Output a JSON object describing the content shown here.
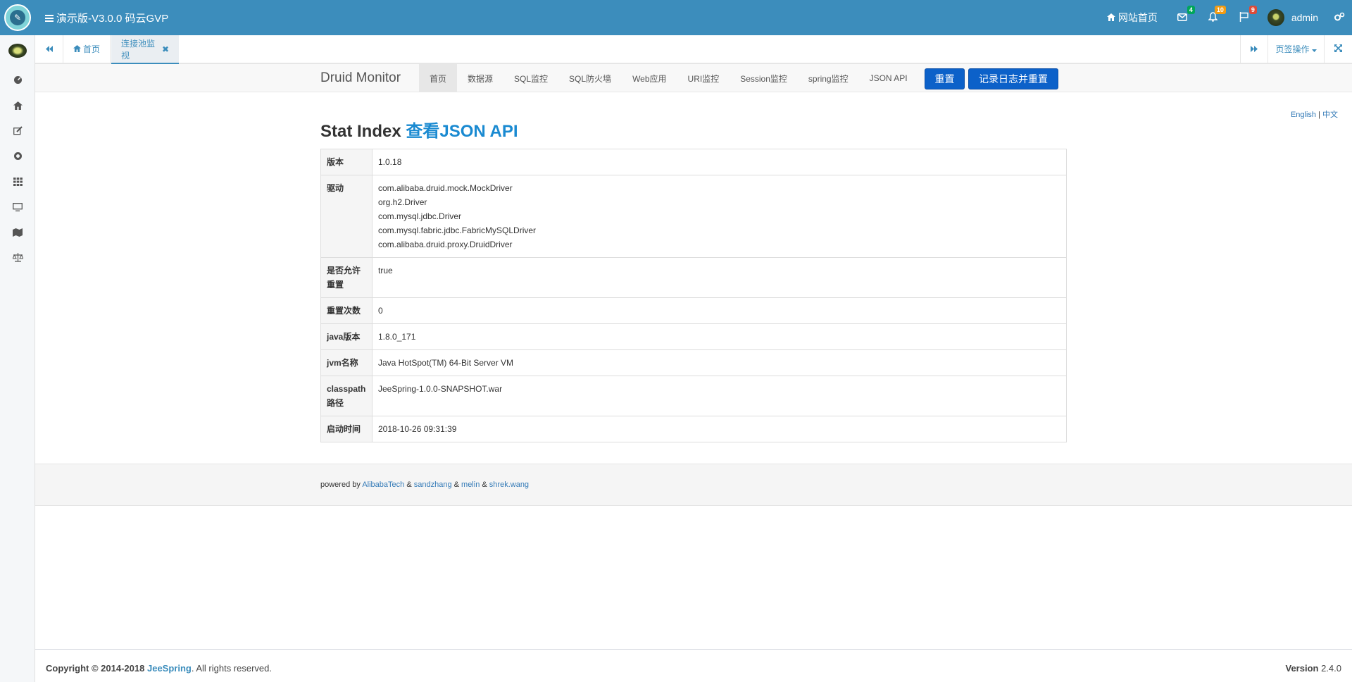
{
  "header": {
    "title": "演示版-V3.0.0 码云GVP",
    "site_home": "网站首页",
    "mail_badge": "4",
    "bell_badge": "10",
    "flag_badge": "9",
    "username": "admin",
    "colors": {
      "primary": "#3c8dbc",
      "mail_badge": "#00a65a",
      "bell_badge": "#f39c12",
      "flag_badge": "#dd4b39"
    }
  },
  "tabs": {
    "items": [
      {
        "label": "首页"
      },
      {
        "label": "连接池监视"
      }
    ],
    "page_ops": "页签操作"
  },
  "druid_nav": {
    "brand": "Druid Monitor",
    "links": [
      "首页",
      "数据源",
      "SQL监控",
      "SQL防火墙",
      "Web应用",
      "URI监控",
      "Session监控",
      "spring监控",
      "JSON API"
    ],
    "reset_button": "重置",
    "log_reset_button": "记录日志并重置"
  },
  "lang": {
    "english": "English",
    "separator": "|",
    "chinese": "中文"
  },
  "content": {
    "heading": "Stat Index",
    "heading_link": "查看JSON API",
    "rows": [
      {
        "label": "版本",
        "value": "1.0.18"
      },
      {
        "label": "驱动",
        "lines": [
          "com.alibaba.druid.mock.MockDriver",
          "org.h2.Driver",
          "com.mysql.jdbc.Driver",
          "com.mysql.fabric.jdbc.FabricMySQLDriver",
          "com.alibaba.druid.proxy.DruidDriver"
        ]
      },
      {
        "label": "是否允许重置",
        "value": "true"
      },
      {
        "label": "重置次数",
        "value": "0"
      },
      {
        "label": "java版本",
        "value": "1.8.0_171"
      },
      {
        "label": "jvm名称",
        "value": "Java HotSpot(TM) 64-Bit Server VM"
      },
      {
        "label": "classpath路径",
        "value": "JeeSpring-1.0.0-SNAPSHOT.war"
      },
      {
        "label": "启动时间",
        "value": "2018-10-26 09:31:39"
      }
    ]
  },
  "powered": {
    "prefix": "powered by",
    "authors": [
      "AlibabaTech",
      "sandzhang",
      "melin",
      "shrek.wang"
    ],
    "amp": "&"
  },
  "footer": {
    "copyright": "Copyright © 2014-2018",
    "brand": "JeeSpring",
    "rights": ". All rights reserved.",
    "version_label": "Version",
    "version": "2.4.0"
  }
}
